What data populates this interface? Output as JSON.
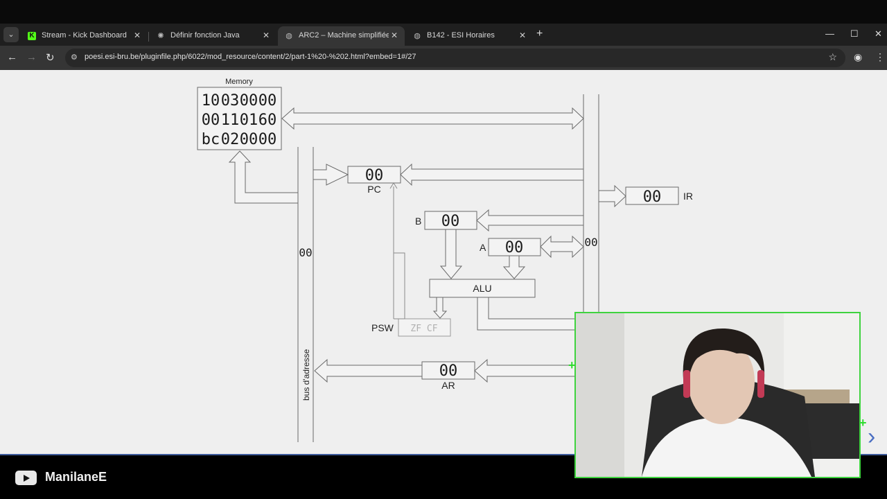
{
  "browser": {
    "tabs": [
      {
        "title": "Stream - Kick Dashboard",
        "icon": "kick-logo-icon",
        "active": false
      },
      {
        "title": "Définir fonction Java",
        "icon": "openai-icon",
        "active": false
      },
      {
        "title": "ARC2 – Machine simplifiée",
        "icon": "globe-icon",
        "active": true
      },
      {
        "title": "B142 - ESI Horaires",
        "icon": "globe-icon",
        "active": false
      }
    ],
    "url": "poesi.esi-bru.be/pluginfile.php/6022/mod_resource/content/2/part-1%20-%202.html?embed=1#/27"
  },
  "diagram": {
    "memory": {
      "label": "Memory",
      "rows": [
        [
          "10",
          "03",
          "00",
          "00"
        ],
        [
          "00",
          "11",
          "01",
          "60"
        ],
        [
          "bc",
          "02",
          "00",
          "00"
        ]
      ]
    },
    "registers": {
      "pc": {
        "label": "PC",
        "value": "00"
      },
      "ir": {
        "label": "IR",
        "value": "00"
      },
      "b": {
        "label": "B",
        "value": "00"
      },
      "a": {
        "label": "A",
        "value": "00"
      },
      "ar": {
        "label": "AR",
        "value": "00"
      },
      "psw": {
        "label": "PSW",
        "flags": "ZF  CF"
      }
    },
    "alu_label": "ALU",
    "data_bus_value": "00",
    "address_bus_value": "00",
    "address_bus_label": "bus d'adresse"
  },
  "overlay": {
    "channel_name": "ManilaneE"
  },
  "colors": {
    "kick_green": "#53fc18",
    "webcam_border": "#3ed33e",
    "slide_nav": "#4b6fc2"
  }
}
